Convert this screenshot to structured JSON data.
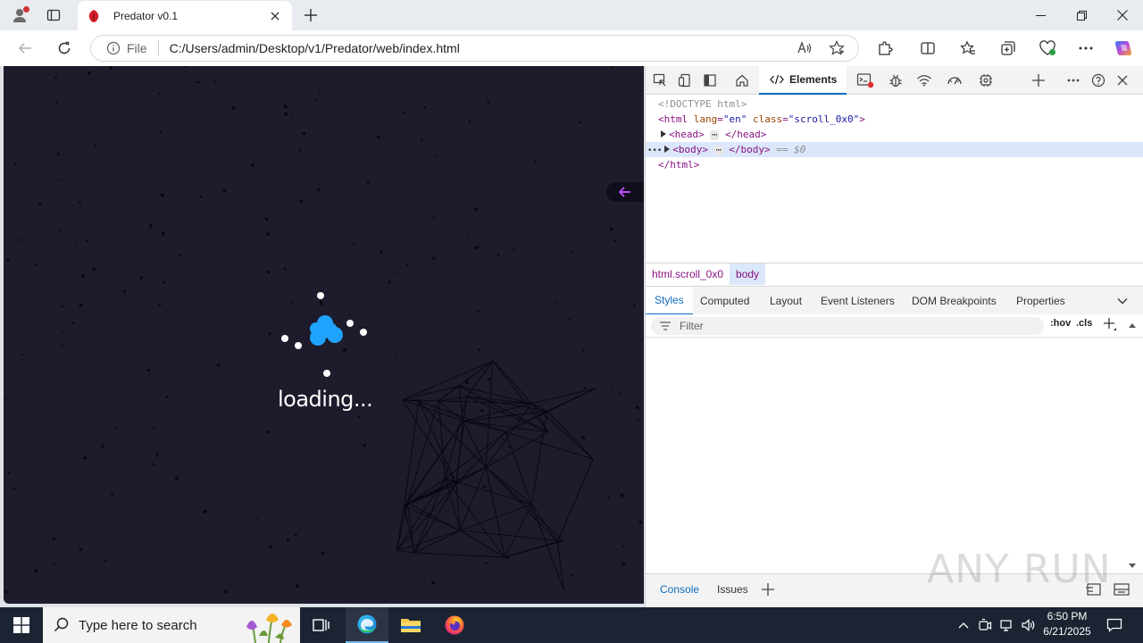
{
  "browser": {
    "tab_title": "Predator v0.1",
    "new_tab": "+",
    "address": {
      "scheme_label": "File",
      "url": "C:/Users/admin/Desktop/v1/Predator/web/index.html"
    }
  },
  "page": {
    "loading_text": "loading..."
  },
  "devtools": {
    "toolbar": {
      "elements_tab": "Elements",
      "add_tab": "+"
    },
    "dom": {
      "doctype": "<!DOCTYPE html>",
      "html_open_tag": "<html",
      "html_attr1_name": "lang",
      "html_attr1_value": "\"en\"",
      "html_attr2_name": "class",
      "html_attr2_value": "\"scroll_0x0\"",
      "html_open_close": ">",
      "head_open": "<head>",
      "head_close": "</head>",
      "body_open": "<body>",
      "body_close": "</body>",
      "selected_marker": "== $0",
      "html_close": "</html>",
      "ellipsis": "⋯",
      "row_menu": "•••"
    },
    "breadcrumbs": [
      "html.scroll_0x0",
      "body"
    ],
    "style_tabs": [
      "Styles",
      "Computed",
      "Layout",
      "Event Listeners",
      "DOM Breakpoints",
      "Properties"
    ],
    "filter": {
      "placeholder": "Filter",
      "hov": ":hov",
      "cls": ".cls"
    },
    "drawer_tabs": [
      "Console",
      "Issues"
    ]
  },
  "watermark": "ANY RUN",
  "taskbar": {
    "search_placeholder": "Type here to search",
    "time": "6:50 PM",
    "date": "6/21/2025"
  },
  "colors": {
    "accent": "#0f6cbd",
    "page_bg": "#1d1b2c",
    "loader_blue": "#1fa3ff",
    "arrow_purple": "#b14cf0"
  }
}
